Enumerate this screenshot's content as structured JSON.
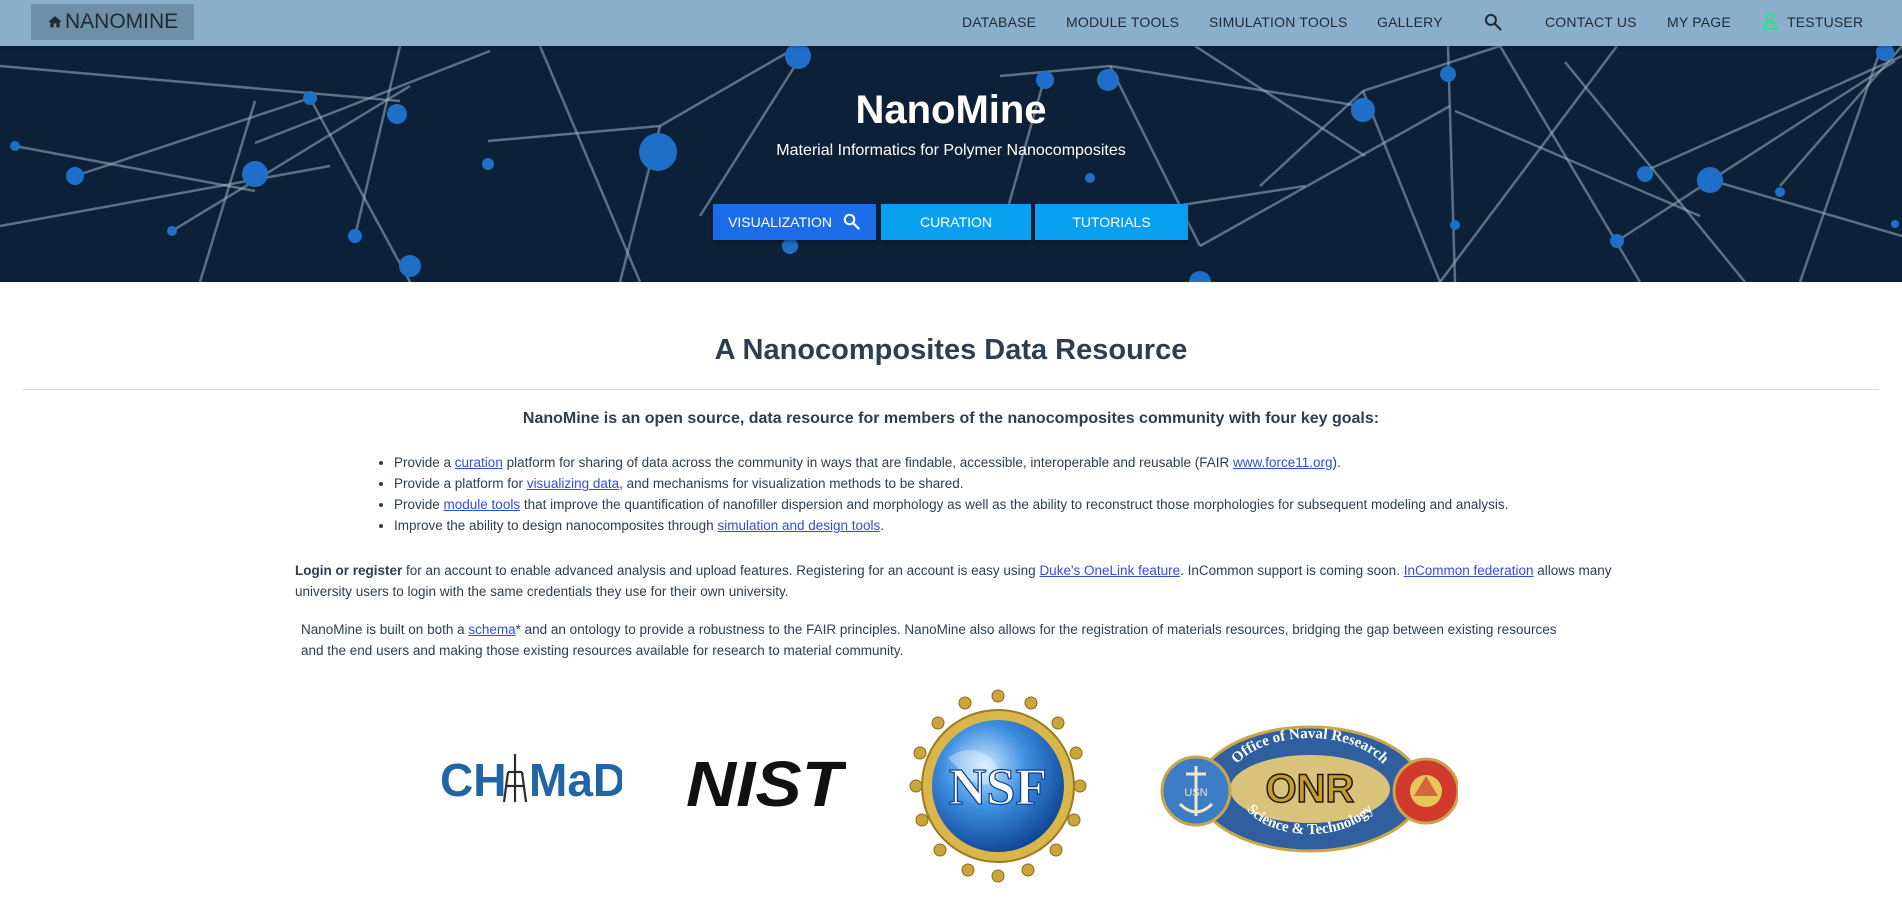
{
  "nav": {
    "brand": "NANOMINE",
    "items": [
      "DATABASE",
      "MODULE TOOLS",
      "SIMULATION TOOLS",
      "GALLERY"
    ],
    "contact": "CONTACT US",
    "mypage": "MY PAGE",
    "user": "TESTUSER"
  },
  "hero": {
    "title": "NanoMine",
    "subtitle": "Material Informatics for Polymer Nanocomposites",
    "buttons": [
      "VISUALIZATION",
      "CURATION",
      "TUTORIALS"
    ]
  },
  "main": {
    "heading": "A Nanocomposites Data Resource",
    "intro": "NanoMine is an open source, data resource for members of the nanocomposites community with four key goals:",
    "goals": [
      {
        "pre": "Provide a ",
        "link": "curation",
        "post": " platform for sharing of data across the community in ways that are findable, accessible, interoperable and reusable (FAIR ",
        "link2": "www.force11.org",
        "post2": ")."
      },
      {
        "pre": "Provide a platform for ",
        "link": "visualizing data",
        "post": ", and mechanisms for visualization methods to be shared."
      },
      {
        "pre": "Provide ",
        "link": "module tools",
        "post": " that improve the quantification of nanofiller dispersion and morphology as well as the ability to reconstruct those morphologies for subsequent modeling and analysis."
      },
      {
        "pre": "Improve the ability to design nanocomposites through ",
        "link": "simulation and design tools",
        "post": "."
      }
    ],
    "login": {
      "bold": "Login or register",
      "text1": " for an account to enable advanced analysis and upload features. Registering for an account is easy using ",
      "link1": "Duke's OneLink feature",
      "text2": ". InCommon support is coming soon. ",
      "link2": "InCommon federation",
      "text3": " allows many university users to login with the same credentials they use for their own university."
    },
    "schema": {
      "text1": "NanoMine is built on both a ",
      "link": "schema",
      "text2": "* and an ontology to provide a robustness to the FAIR principles. NanoMine also allows for the registration of materials resources, bridging the gap between existing resources and the end users and making those existing resources available for research to material community."
    }
  },
  "logos": {
    "chimad": "CHiMaD",
    "nist": "NIST",
    "nsf": "NSF",
    "onr": "ONR",
    "onr_top": "Office of Naval Research",
    "onr_bottom": "Science & Technology",
    "usn": "USN"
  },
  "colors": {
    "topbar": "#8aafca",
    "hero": "#0c2138",
    "button_primary": "#1b6ce8",
    "button": "#09a1ef",
    "link": "#2f4ee0"
  }
}
